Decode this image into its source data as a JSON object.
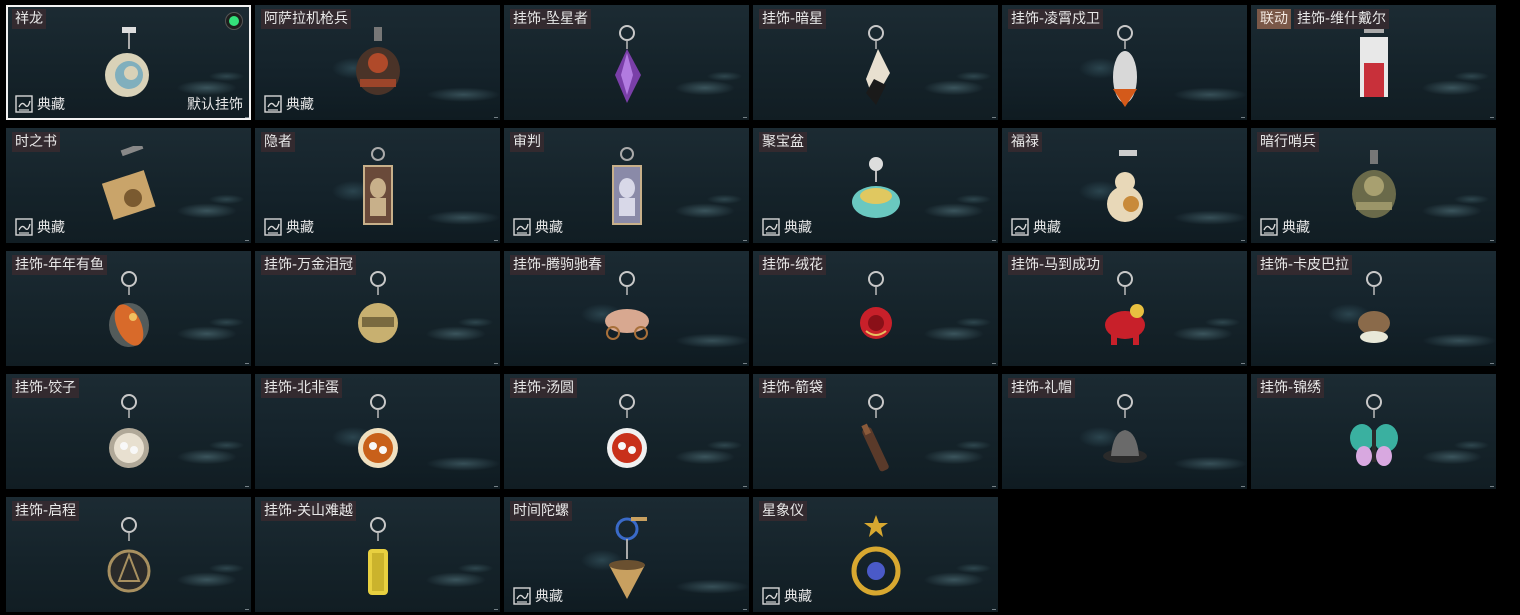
{
  "cards": [
    {
      "name": "祥龙",
      "collection": "典藏",
      "default": "默认挂饰",
      "selected": true,
      "icon": "dragon-charm-icon",
      "art": "swirl",
      "colors": [
        "#d9d2b8",
        "#5a9fbf"
      ]
    },
    {
      "name": "阿萨拉机枪兵",
      "collection": "典藏",
      "icon": "gunner-charm-icon",
      "art": "figure",
      "colors": [
        "#4a3328",
        "#b04a2a"
      ]
    },
    {
      "tag": "挂饰",
      "name": "坠星者",
      "icon": "purple-crystal-icon",
      "art": "crystal",
      "colors": [
        "#7a3fa8",
        "#b27be0"
      ]
    },
    {
      "tag": "挂饰",
      "name": "暗星",
      "icon": "dark-star-icon",
      "art": "feather",
      "colors": [
        "#e8e0d0",
        "#1a1a1a"
      ]
    },
    {
      "tag": "挂饰",
      "name": "凌霄戍卫",
      "icon": "rocket-icon",
      "art": "rocket",
      "colors": [
        "#d8d8d8",
        "#d45a1a"
      ]
    },
    {
      "tag": "挂饰",
      "collab": "联动",
      "name": "维什戴尔",
      "icon": "card-tag-icon",
      "art": "card",
      "colors": [
        "#e8e8e8",
        "#c8303a"
      ]
    },
    {
      "name": "时之书",
      "collection": "典藏",
      "icon": "book-icon",
      "art": "book",
      "colors": [
        "#c9a46a",
        "#7a5a30"
      ]
    },
    {
      "name": "隐者",
      "collection": "典藏",
      "icon": "hermit-card-icon",
      "art": "tarot",
      "colors": [
        "#6a4a3a",
        "#c8b08a"
      ]
    },
    {
      "name": "审判",
      "collection": "典藏",
      "icon": "judgement-card-icon",
      "art": "tarot",
      "colors": [
        "#8a8aa8",
        "#d8d8e8"
      ]
    },
    {
      "name": "聚宝盆",
      "collection": "典藏",
      "icon": "treasure-bowl-icon",
      "art": "bowl",
      "colors": [
        "#6ac8c0",
        "#e0c860"
      ]
    },
    {
      "name": "福禄",
      "collection": "典藏",
      "icon": "gourd-icon",
      "art": "gourd",
      "colors": [
        "#e8d8b8",
        "#c88a3a"
      ]
    },
    {
      "name": "暗行哨兵",
      "collection": "典藏",
      "icon": "sentinel-icon",
      "art": "figure",
      "colors": [
        "#6a6a4a",
        "#a8a070"
      ]
    },
    {
      "tag": "挂饰",
      "name": "年年有鱼",
      "icon": "fish-icon",
      "art": "fish",
      "colors": [
        "#d86a2a",
        "#f0c060"
      ]
    },
    {
      "tag": "挂饰",
      "name": "万金泪冠",
      "icon": "coin-crown-icon",
      "art": "coin",
      "colors": [
        "#c8b070",
        "#7a6a40"
      ]
    },
    {
      "tag": "挂饰",
      "name": "腾驹驰春",
      "icon": "carriage-icon",
      "art": "carriage",
      "colors": [
        "#d8a890",
        "#a8703a"
      ]
    },
    {
      "tag": "挂饰",
      "name": "绒花",
      "icon": "rose-icon",
      "art": "rose",
      "colors": [
        "#c8202a",
        "#e8c060"
      ]
    },
    {
      "tag": "挂饰",
      "name": "马到成功",
      "icon": "horse-icon",
      "art": "horse",
      "colors": [
        "#c8202a",
        "#e8c040"
      ]
    },
    {
      "tag": "挂饰",
      "name": "卡皮巴拉",
      "icon": "capybara-icon",
      "art": "capybara",
      "colors": [
        "#8a6a4a",
        "#e8e8d8"
      ]
    },
    {
      "tag": "挂饰",
      "name": "饺子",
      "icon": "dumpling-icon",
      "art": "plate",
      "colors": [
        "#e8e0d0",
        "#b0a898"
      ]
    },
    {
      "tag": "挂饰",
      "name": "北非蛋",
      "icon": "shakshuka-icon",
      "art": "plate",
      "colors": [
        "#c8601a",
        "#f0e0c0"
      ]
    },
    {
      "tag": "挂饰",
      "name": "汤圆",
      "icon": "tangyuan-icon",
      "art": "plate",
      "colors": [
        "#c8301a",
        "#f0f0f0"
      ]
    },
    {
      "tag": "挂饰",
      "name": "箭袋",
      "icon": "quiver-icon",
      "art": "quiver",
      "colors": [
        "#5a3a2a",
        "#8a5a3a"
      ]
    },
    {
      "tag": "挂饰",
      "name": "礼帽",
      "icon": "hat-icon",
      "art": "hat",
      "colors": [
        "#6a6a6a",
        "#2a2a2a"
      ]
    },
    {
      "tag": "挂饰",
      "name": "锦绣",
      "icon": "butterfly-icon",
      "art": "butterfly",
      "colors": [
        "#3ab0a0",
        "#d8a8e0"
      ]
    },
    {
      "tag": "挂饰",
      "name": "启程",
      "icon": "compass-medal-icon",
      "art": "medal",
      "colors": [
        "#a89060",
        "#2a2a2a"
      ]
    },
    {
      "tag": "挂饰",
      "name": "关山难越",
      "icon": "jade-bar-icon",
      "art": "bar",
      "colors": [
        "#e8d040",
        "#b8a020"
      ]
    },
    {
      "name": "时间陀螺",
      "collection": "典藏",
      "icon": "spinning-top-icon",
      "art": "top",
      "colors": [
        "#c8a060",
        "#6a5030"
      ]
    },
    {
      "name": "星象仪",
      "collection": "典藏",
      "icon": "astrolabe-icon",
      "art": "astrolabe",
      "colors": [
        "#d8a830",
        "#4a5ac8"
      ]
    }
  ]
}
